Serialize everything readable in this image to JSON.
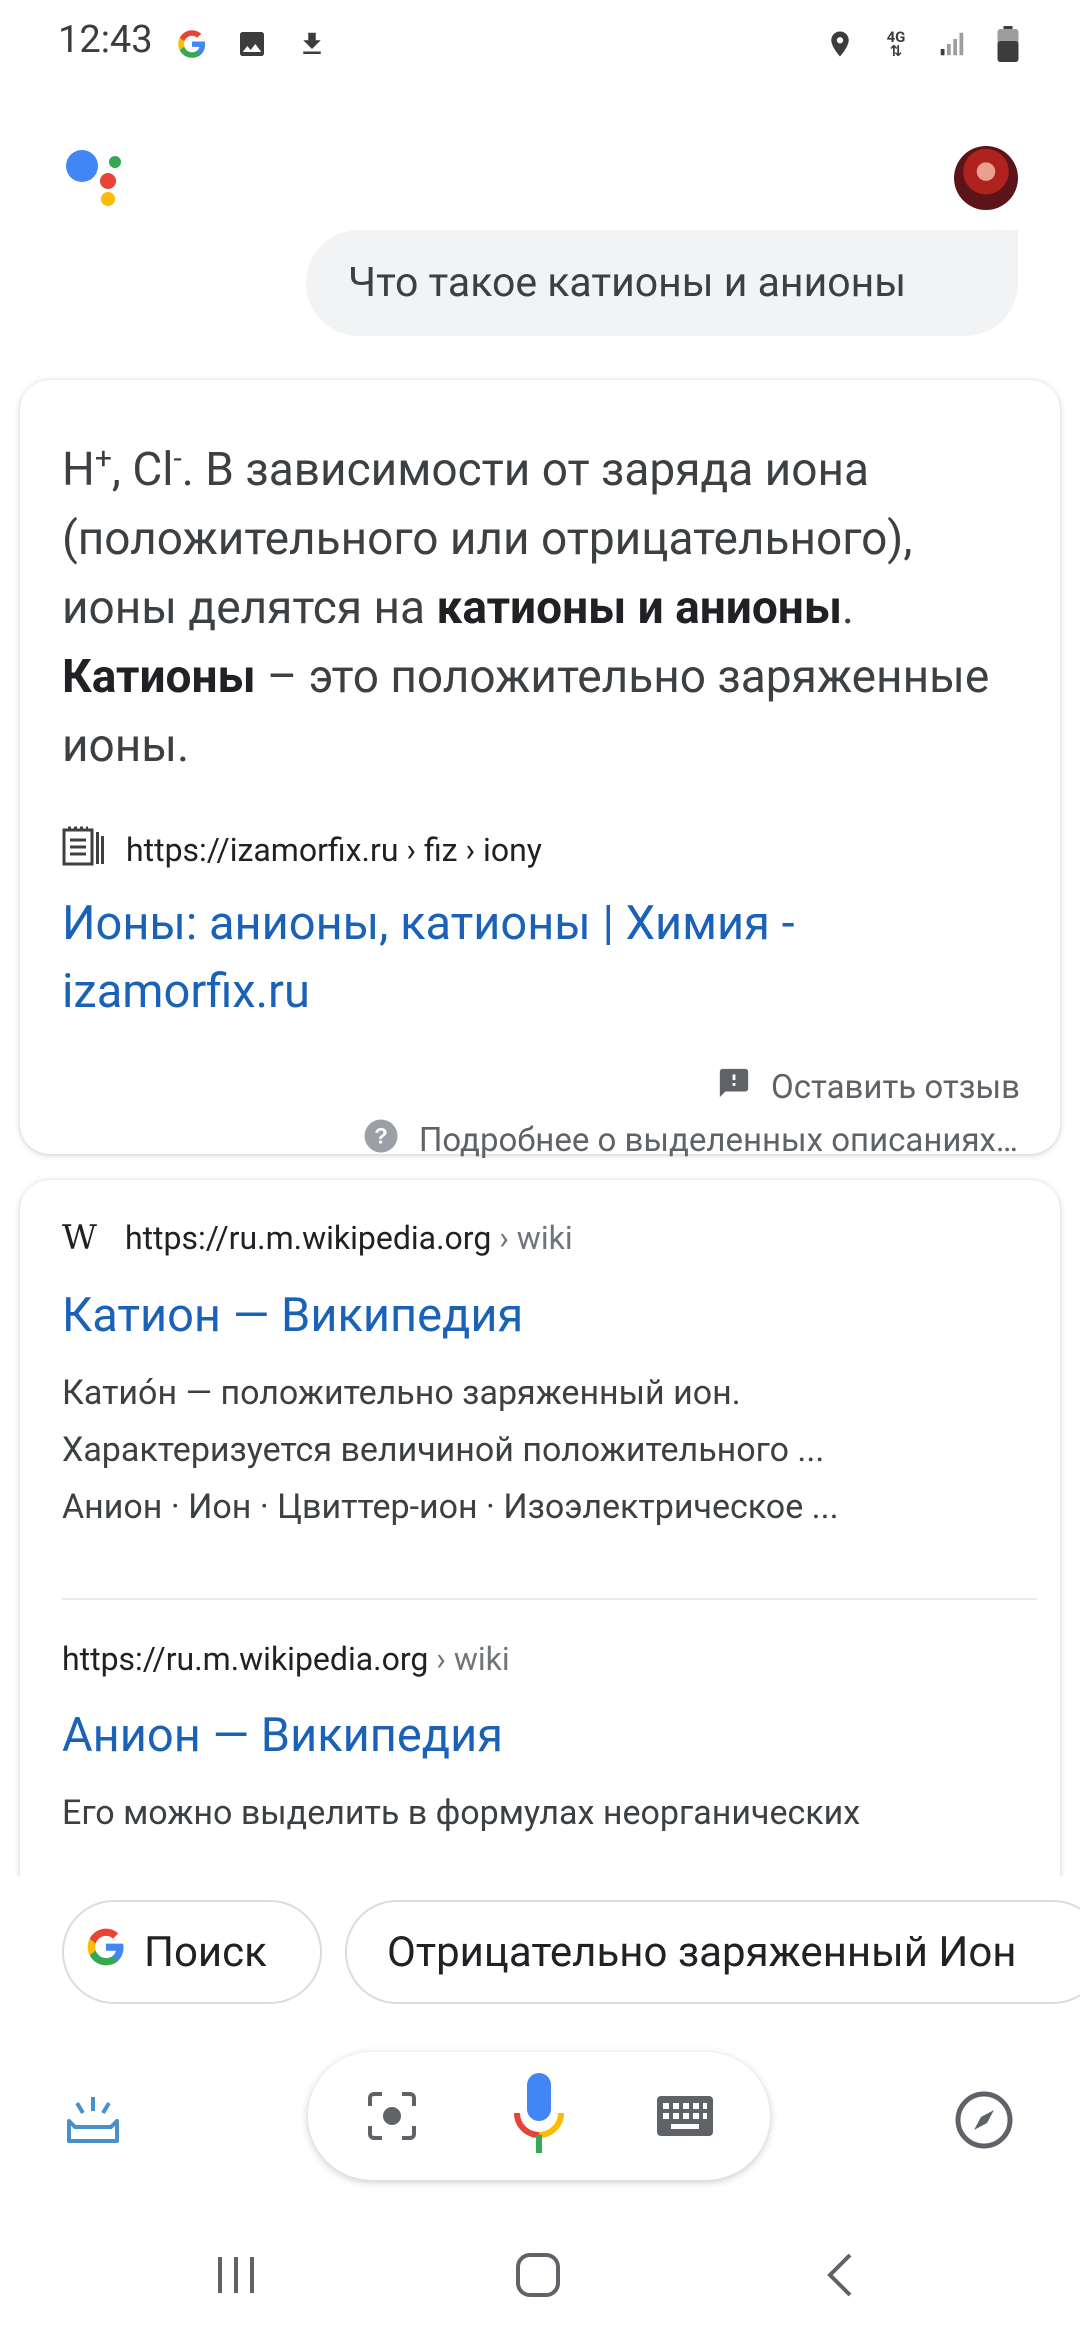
{
  "status_bar": {
    "time": "12:43",
    "left_icons": [
      "google-icon",
      "image-icon",
      "download-icon"
    ],
    "right_icons": [
      "location-icon",
      "4g-icon",
      "signal-icon",
      "battery-icon"
    ],
    "network": "4G"
  },
  "query": "Что такое катионы и анионы",
  "answer_card": {
    "snippet_pre": "H",
    "snippet_sup1": "+",
    "snippet_mid1": ", Cl",
    "snippet_sup2": "-",
    "snippet_mid2": ". В зависимости от заряда иона (положительного или отрицательного), ионы делятся на ",
    "snippet_bold1": "катионы и анионы",
    "snippet_mid3": ". ",
    "snippet_bold2": "Катионы",
    "snippet_end": " – это положительно заряженные ионы.",
    "source_url": "https://izamorfix.ru › fiz › iony",
    "title": "Ионы: анионы, катионы | Химия - izamorfix.ru",
    "feedback_label": "Оставить отзыв",
    "about_label": "Подробнее о выделенных описаниях…"
  },
  "results": [
    {
      "url": "https://ru.m.wikipedia.org",
      "crumb": "› wiki",
      "title": "Катион — Википедия",
      "desc_line1": "Катио́н — положительно заряженный ион.",
      "desc_line2": "Характеризуется величиной положительного ...",
      "desc_line3": "Анион · Ион · Цвиттер-ион · Изоэлектрическое ..."
    },
    {
      "url": "https://ru.m.wikipedia.org",
      "crumb": "› wiki",
      "title": "Анион — Википедия",
      "desc_line1": "Его можно выделить в формулах неорганических"
    }
  ],
  "chips": {
    "search_label": "Поиск",
    "suggestion_label": "Отрицательно заряженный Ион"
  },
  "colors": {
    "link": "#1a61b8",
    "google_blue": "#4285f4",
    "google_red": "#ea4335",
    "google_yellow": "#fbbc05",
    "google_green": "#34a853"
  }
}
